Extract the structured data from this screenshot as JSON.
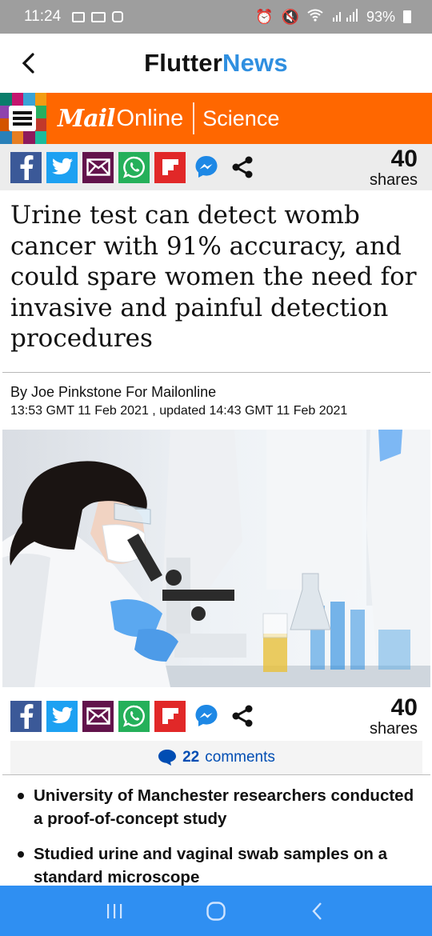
{
  "status_bar": {
    "time": "11:24",
    "battery": "93%"
  },
  "app_bar": {
    "title_part1": "Flutter",
    "title_part2": "News"
  },
  "site_header": {
    "logo_mail": "Mail",
    "logo_online": "Online",
    "channel": "Science",
    "brand_color": "#ff6700"
  },
  "share_top": {
    "count": "40",
    "label": "shares",
    "buttons": [
      "facebook-icon",
      "twitter-icon",
      "email-icon",
      "whatsapp-icon",
      "flipboard-icon",
      "messenger-icon",
      "share-icon"
    ]
  },
  "article": {
    "headline": "Urine test can detect womb cancer with 91% accuracy, and could spare women the need for invasive and painful detection procedures",
    "byline": "By Joe Pinkstone For Mailonline",
    "dates": "13:53 GMT 11 Feb 2021 , updated 14:43 GMT 11 Feb 2021",
    "bullets": [
      "University of Manchester researchers conducted a proof-of-concept study",
      "Studied urine and vaginal swab samples on a standard microscope"
    ]
  },
  "share_bottom": {
    "count": "40",
    "label": "shares"
  },
  "comments": {
    "count": "22",
    "label": "comments"
  },
  "colors": {
    "accent_blue": "#2f8fe0",
    "nav_blue": "#2f8ff2",
    "link_blue": "#004db3"
  }
}
